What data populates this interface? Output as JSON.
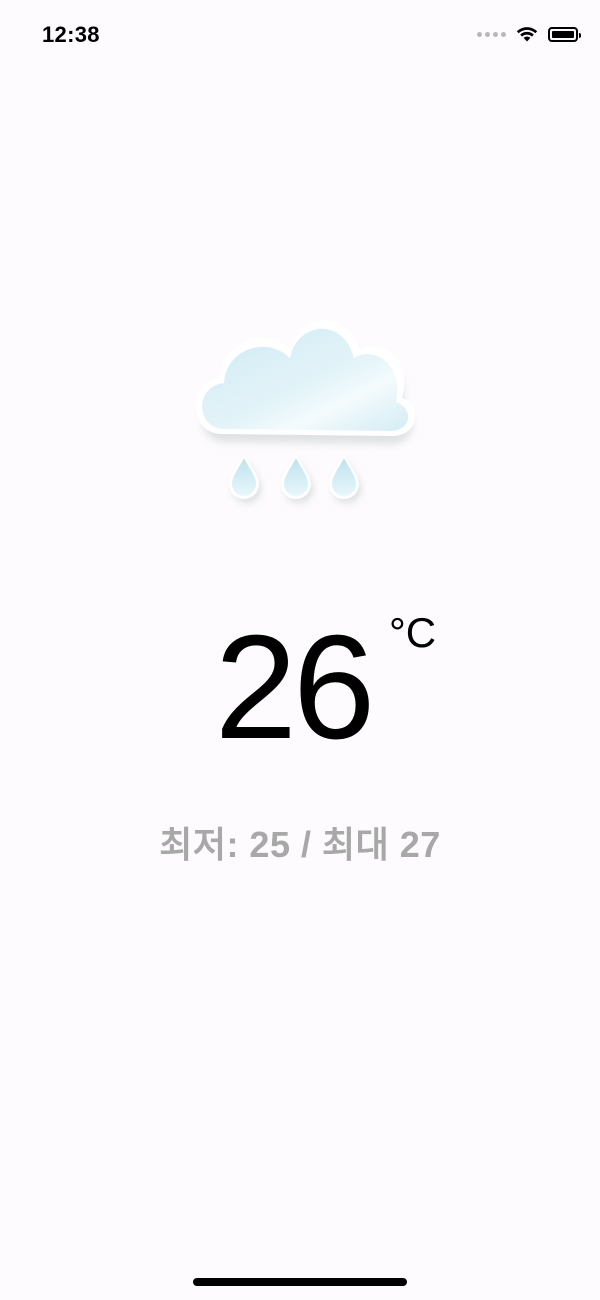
{
  "status_bar": {
    "time": "12:38",
    "icons": [
      "signal-dots-icon",
      "wifi-icon",
      "battery-icon"
    ]
  },
  "weather": {
    "condition_icon": "rain-cloud-icon",
    "temperature": "26",
    "unit": "°C",
    "range_text": "최저: 25 / 최대 27"
  },
  "colors": {
    "background": "#fdfbfd",
    "range_text": "#a8a8a8",
    "cloud": "#d6eef5"
  }
}
